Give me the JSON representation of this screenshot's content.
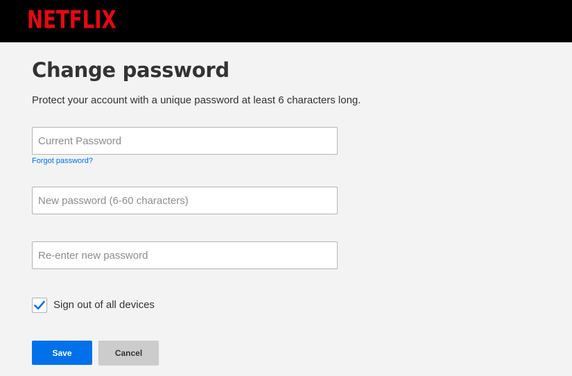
{
  "header": {
    "logo_text": "NETFLIX",
    "logo_color": "#e50914"
  },
  "page": {
    "title": "Change password",
    "subtitle": "Protect your account with a unique password at least 6 characters long."
  },
  "form": {
    "current_password": {
      "placeholder": "Current Password",
      "value": ""
    },
    "forgot_link": "Forgot password?",
    "new_password": {
      "placeholder": "New password (6-60 characters)",
      "value": ""
    },
    "confirm_password": {
      "placeholder": "Re-enter new password",
      "value": ""
    },
    "sign_out_all": {
      "label": "Sign out of all devices",
      "checked": true,
      "icon": "checkmark-icon"
    }
  },
  "actions": {
    "save_label": "Save",
    "cancel_label": "Cancel"
  },
  "colors": {
    "accent": "#0071eb",
    "header_bg": "#000000",
    "page_bg": "#f3f3f3"
  }
}
